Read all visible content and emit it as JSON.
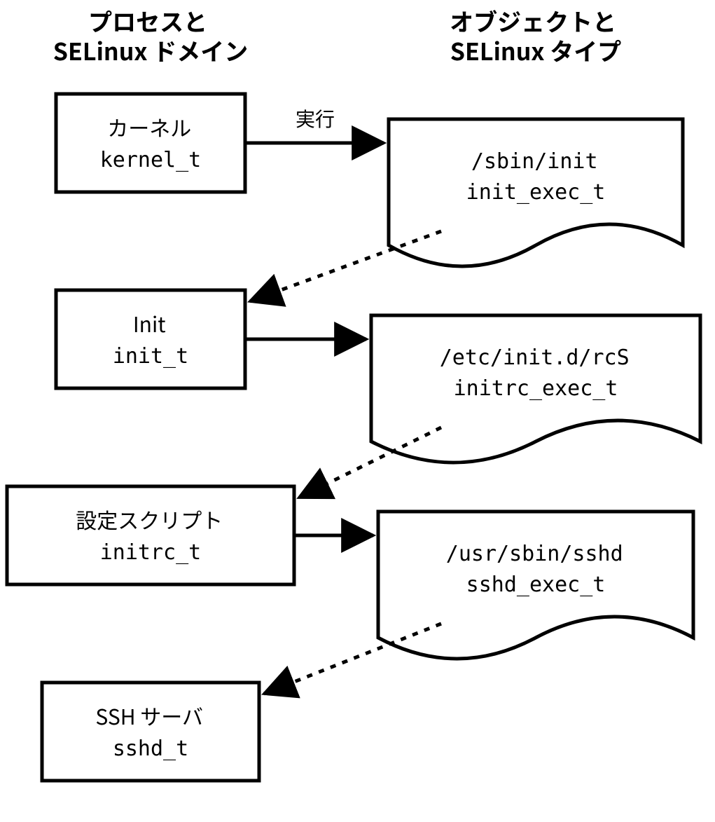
{
  "titles": {
    "left_line1": "プロセスと",
    "left_line2": "SELinux ドメイン",
    "right_line1": "オブジェクトと",
    "right_line2": "SELinux タイプ"
  },
  "processes": [
    {
      "label": "カーネル",
      "type": "kernel_t"
    },
    {
      "label": "Init",
      "type": "init_t"
    },
    {
      "label": "設定スクリプト",
      "type": "initrc_t"
    },
    {
      "label": "SSH サーバ",
      "type": "sshd_t"
    }
  ],
  "objects": [
    {
      "path": "/sbin/init",
      "type": "init_exec_t"
    },
    {
      "path": "/etc/init.d/rcS",
      "type": "initrc_exec_t"
    },
    {
      "path": "/usr/sbin/sshd",
      "type": "sshd_exec_t"
    }
  ],
  "edge_label": "実行"
}
